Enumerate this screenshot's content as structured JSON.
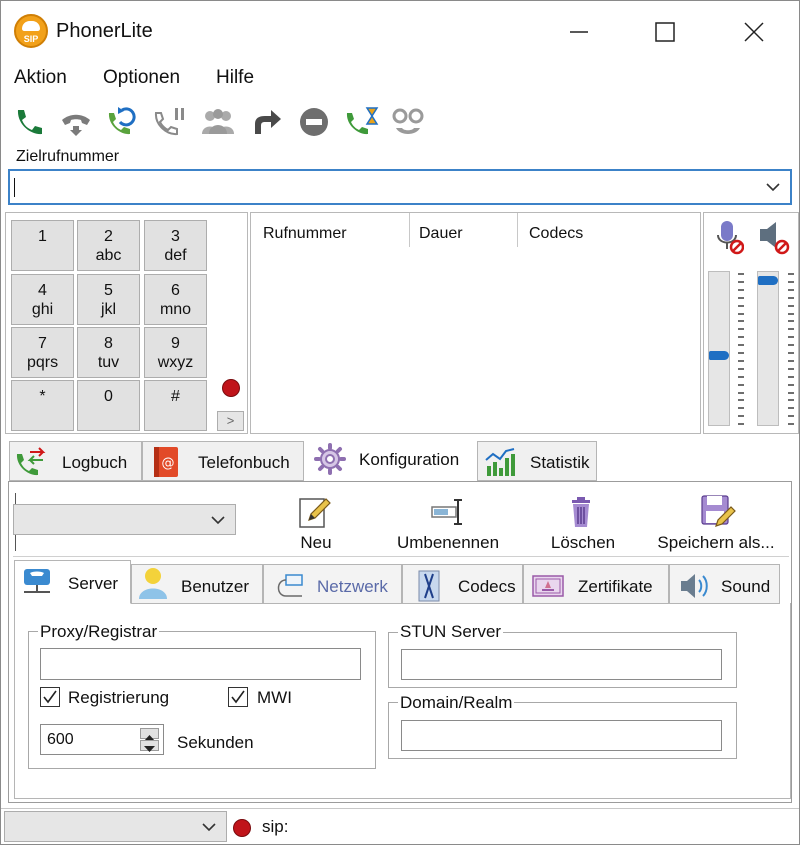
{
  "window": {
    "title": "PhonerLite",
    "logo_text": "SIP"
  },
  "menu": {
    "items": [
      "Aktion",
      "Optionen",
      "Hilfe"
    ]
  },
  "destination": {
    "label": "Zielrufnummer",
    "value": ""
  },
  "keypad": {
    "keys": [
      {
        "digit": "1",
        "letters": ""
      },
      {
        "digit": "2",
        "letters": "abc"
      },
      {
        "digit": "3",
        "letters": "def"
      },
      {
        "digit": "4",
        "letters": "ghi"
      },
      {
        "digit": "5",
        "letters": "jkl"
      },
      {
        "digit": "6",
        "letters": "mno"
      },
      {
        "digit": "7",
        "letters": "pqrs"
      },
      {
        "digit": "8",
        "letters": "tuv"
      },
      {
        "digit": "9",
        "letters": "wxyz"
      },
      {
        "digit": "*",
        "letters": ""
      },
      {
        "digit": "0",
        "letters": ""
      },
      {
        "digit": "#",
        "letters": ""
      }
    ],
    "expand_label": ">"
  },
  "call_list": {
    "columns": [
      "Rufnummer",
      "Dauer",
      "Codecs"
    ]
  },
  "volume": {
    "microphone_level": 0.55,
    "speaker_level": 0.03
  },
  "main_tabs": [
    "Logbuch",
    "Telefonbuch",
    "Konfiguration",
    "Statistik"
  ],
  "config_toolbar": {
    "new": "Neu",
    "rename": "Umbenennen",
    "delete": "Löschen",
    "save_as": "Speichern als..."
  },
  "sub_tabs": [
    "Server",
    "Benutzer",
    "Netzwerk",
    "Codecs",
    "Zertifikate",
    "Sound"
  ],
  "server": {
    "proxy_label": "Proxy/Registrar",
    "proxy_value": "",
    "registration_label": "Registrierung",
    "mwi_label": "MWI",
    "seconds_value": "600",
    "seconds_label": "Sekunden",
    "stun_label": "STUN  Server",
    "stun_value": "",
    "domain_label": "Domain/Realm",
    "domain_value": ""
  },
  "status": {
    "sip_label": "sip:"
  },
  "colors": {
    "green": "#1b7a3a",
    "gray_icon": "#7b7b7b",
    "accent_blue": "#3c82c8",
    "status_red": "#c0141a"
  }
}
